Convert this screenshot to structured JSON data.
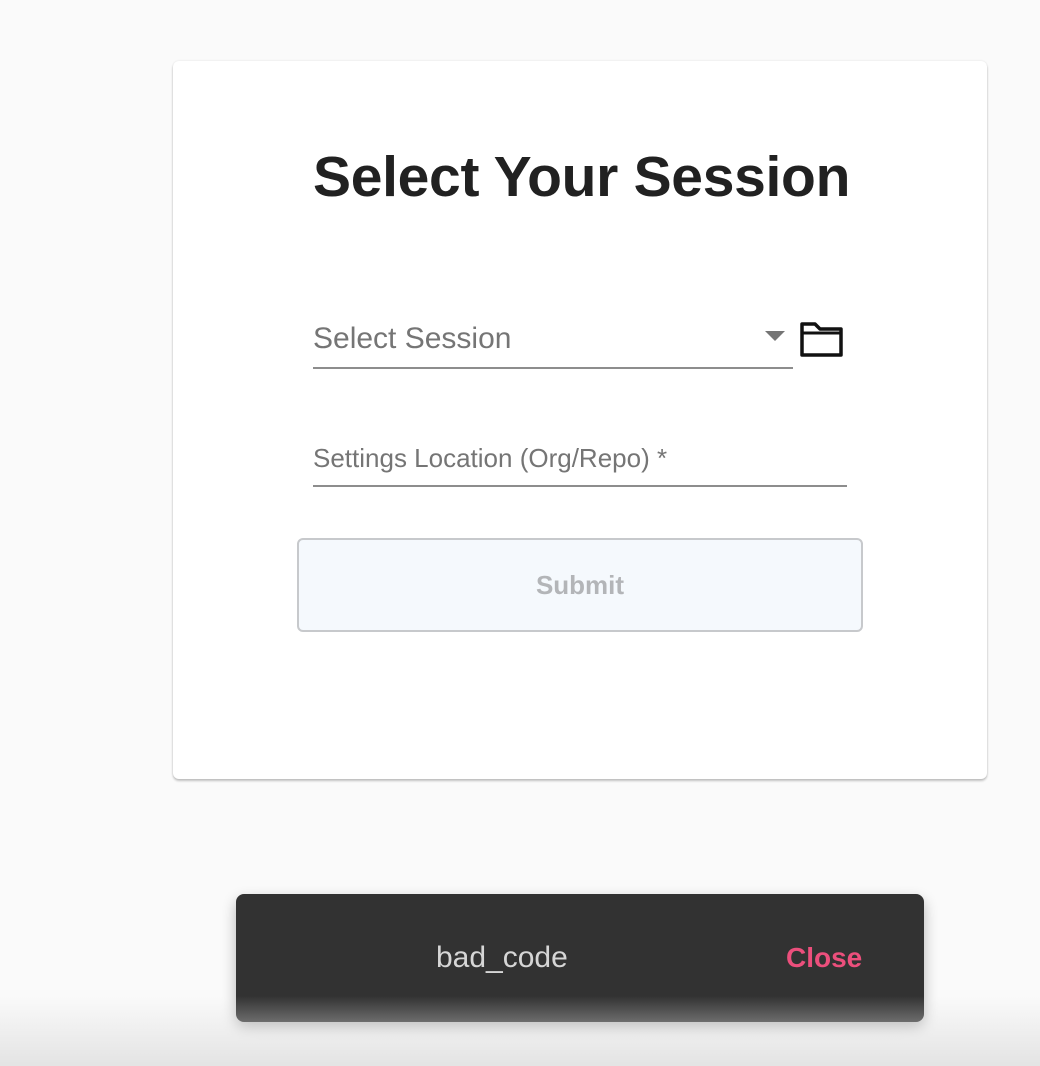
{
  "card": {
    "title": "Select Your Session",
    "session_select": {
      "placeholder": "Select Session",
      "icon": "chevron-down-icon"
    },
    "folder_button": {
      "icon": "folder-icon"
    },
    "settings_location": {
      "label": "Settings Location (Org/Repo) *",
      "value": ""
    },
    "submit_label": "Submit",
    "submit_disabled": true
  },
  "snackbar": {
    "message": "bad_code",
    "action_label": "Close"
  },
  "colors": {
    "title": "#212121",
    "field_text": "#757575",
    "submit_bg": "#f5f9fd",
    "submit_text": "#b3b5b8",
    "snackbar_bg": "#323232",
    "snackbar_action": "#ec4f7c"
  }
}
